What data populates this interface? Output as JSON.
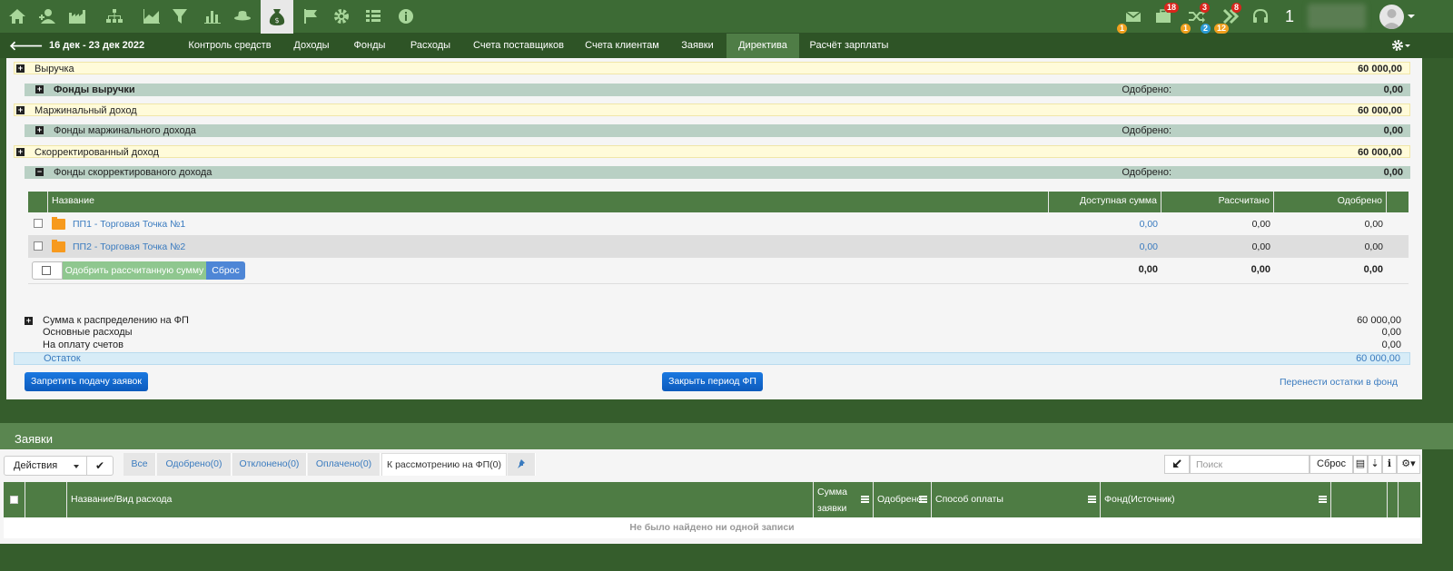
{
  "topbar": {
    "badges": {
      "mail_bottom": "1",
      "bag_top": "18",
      "bag_bottom": "1",
      "shuffle_top": "3",
      "shuffle_bottom": "2",
      "chevrons_top": "8",
      "chevrons_bottom": "12"
    },
    "user_counter": "1"
  },
  "nav": {
    "back": "🡐",
    "date_range": "16 дек - 23 дек 2022",
    "tabs": [
      "Контроль средств",
      "Доходы",
      "Фонды",
      "Расходы",
      "Счета поставщиков",
      "Счета клиентам",
      "Заявки",
      "Директива",
      "Расчёт зарплаты"
    ],
    "active_tab": "Директива"
  },
  "finance": {
    "rows": [
      {
        "label": "Выручка",
        "value": "60 000,00",
        "type": "yellow"
      },
      {
        "label": "Фонды выручки",
        "approved_label": "Одобрено:",
        "value": "0,00",
        "type": "green"
      },
      {
        "label": "Маржинальный доход",
        "value": "60 000,00",
        "type": "yellow"
      },
      {
        "label": "Фонды маржинального дохода",
        "approved_label": "Одобрено:",
        "value": "0,00",
        "type": "green"
      },
      {
        "label": "Скорректированный доход",
        "value": "60 000,00",
        "type": "yellow"
      },
      {
        "label": "Фонды скорректированого дохода",
        "approved_label": "Одобрено:",
        "value": "0,00",
        "type": "green"
      }
    ]
  },
  "funds_table": {
    "headers": {
      "name": "Название",
      "available": "Доступная сумма",
      "calculated": "Рассчитано",
      "approved": "Одобрено"
    },
    "rows": [
      {
        "name": "ПП1 - Торговая Точка №1",
        "available": "0,00",
        "calculated": "0,00",
        "approved": "0,00"
      },
      {
        "name": "ПП2 - Торговая Точка №2",
        "available": "0,00",
        "calculated": "0,00",
        "approved": "0,00"
      }
    ],
    "approve_button": "Одобрить рассчитанную сумму",
    "reset_button": "Сброс",
    "totals": {
      "available": "0,00",
      "calculated": "0,00",
      "approved": "0,00"
    }
  },
  "summary": {
    "distribute_label": "Сумма к распределению на ФП",
    "distribute_value": "60 000,00",
    "main_expenses_label": "Основные расходы",
    "main_expenses_value": "0,00",
    "invoices_label": "На оплату счетов",
    "invoices_value": "0,00",
    "rest_label": "Остаток",
    "rest_value": "60 000,00"
  },
  "buttons": {
    "forbid": "Запретить подачу заявок",
    "close_period": "Закрыть период ФП",
    "transfer_link": "Перенести остатки в фонд"
  },
  "requests": {
    "title": "Заявки",
    "actions_label": "Действия",
    "tabs": [
      "Все",
      "Одобрено(0)",
      "Отклонено(0)",
      "Оплачено(0)",
      "К рассмотрению на ФП(0)"
    ],
    "active_tab": "К рассмотрению на ФП(0)",
    "search_placeholder": "Поиск",
    "search_reset": "Сброс",
    "columns": {
      "name": "Название/Вид расхода",
      "amount_line1": "Сумма",
      "amount_line2": "заявки",
      "approved": "Одобрено",
      "payment": "Способ оплаты",
      "fund": "Фонд(Источник)"
    },
    "empty": "Не было найдено ни одной записи"
  }
}
